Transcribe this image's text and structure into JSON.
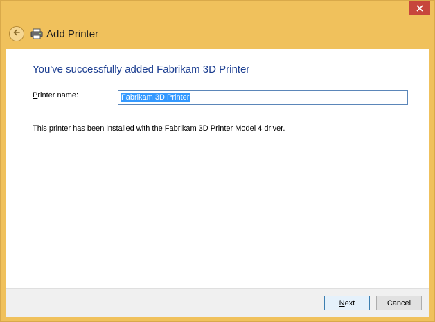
{
  "window": {
    "title": "Add Printer",
    "accent_color": "#f0c15c",
    "close_color": "#c7463c"
  },
  "icons": {
    "back": "back-arrow-icon",
    "printer": "printer-icon",
    "close": "close-icon"
  },
  "main": {
    "heading": "You've successfully added Fabrikam 3D Printer",
    "printer_name_label_access": "P",
    "printer_name_label_rest": "rinter name:",
    "printer_name_value": "Fabrikam 3D Printer",
    "info_text": "This printer has been installed with the Fabrikam 3D Printer Model 4 driver."
  },
  "footer": {
    "next_access": "N",
    "next_rest": "ext",
    "cancel_label": "Cancel"
  }
}
